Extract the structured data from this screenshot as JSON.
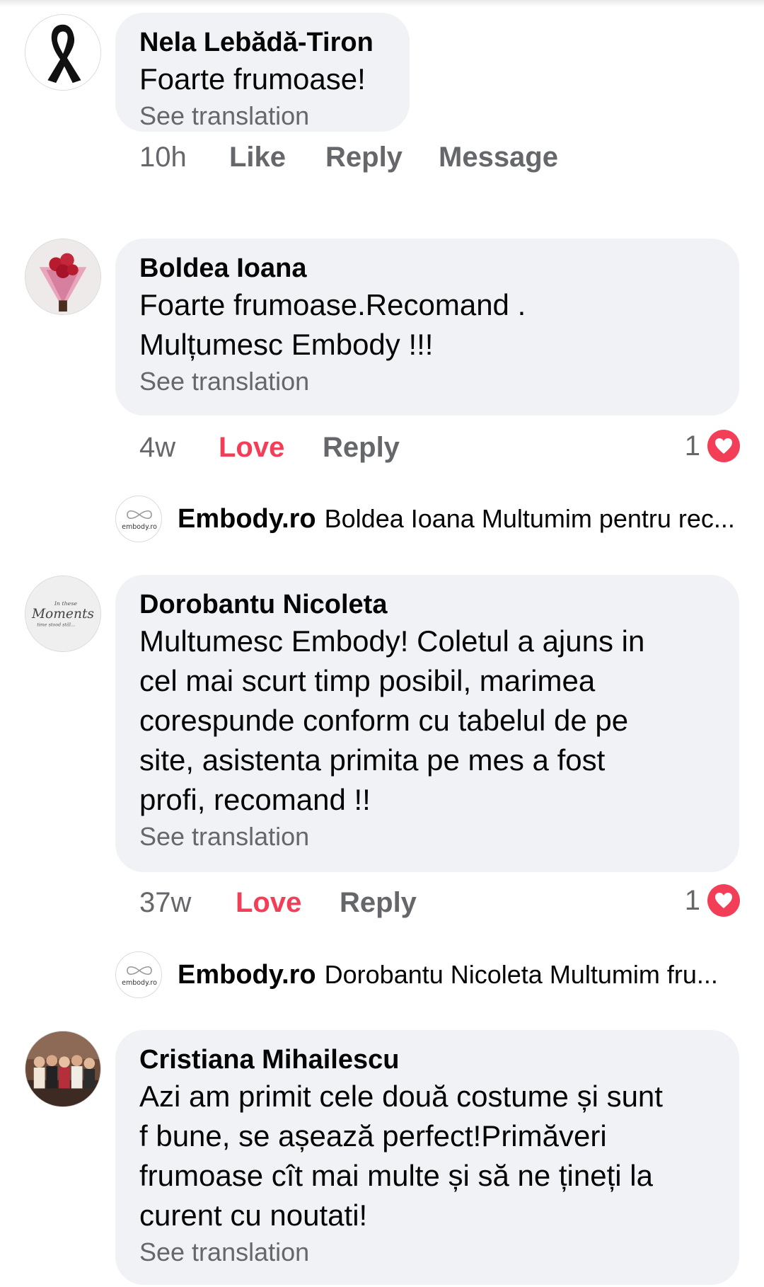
{
  "comments": [
    {
      "author": "Nela Lebădă-Tiron",
      "lines": [
        "Foarte frumoase!"
      ],
      "see_translation": "See translation",
      "time": "10h",
      "actions": [
        "Like",
        "Reply",
        "Message"
      ]
    },
    {
      "author": "Boldea Ioana",
      "lines": [
        "Foarte frumoase.Recomand .",
        "Mulțumesc Embody !!!"
      ],
      "see_translation": "See translation",
      "time": "4w",
      "actions": [
        "Love",
        "Reply"
      ],
      "reaction_count": "1",
      "reply": {
        "name": "Embody.ro",
        "text": "Boldea Ioana Multumim pentru rec...",
        "avatar_text": "embody.ro"
      }
    },
    {
      "author": "Dorobantu Nicoleta",
      "lines": [
        "Multumesc Embody! Coletul a ajuns in",
        "cel mai scurt timp posibil, marimea",
        "corespunde conform cu tabelul de pe",
        "site, asistenta primita pe mes a fost",
        "profi, recomand !!"
      ],
      "see_translation": "See translation",
      "time": "37w",
      "actions": [
        "Love",
        "Reply"
      ],
      "reaction_count": "1",
      "avatar_text": [
        "In these",
        "Moments",
        "time stood still..."
      ],
      "reply": {
        "name": "Embody.ro",
        "text": "Dorobantu Nicoleta Multumim fru...",
        "avatar_text": "embody.ro"
      }
    },
    {
      "author": "Cristiana Mihailescu",
      "lines": [
        "Azi am primit cele două costume și sunt",
        "f bune, se așează perfect!Primăveri",
        "frumoase cît mai multe și să ne țineți la",
        "curent cu noutati!"
      ],
      "see_translation": "See translation"
    }
  ],
  "colors": {
    "bubble": "#f0f2f5",
    "secondary_text": "#65676b",
    "love": "#f33e58"
  },
  "icons": [
    "black-ribbon-avatar",
    "flower-bouquet-avatar",
    "moments-avatar",
    "group-photo-avatar",
    "embody-logo",
    "heart-reaction-icon"
  ]
}
